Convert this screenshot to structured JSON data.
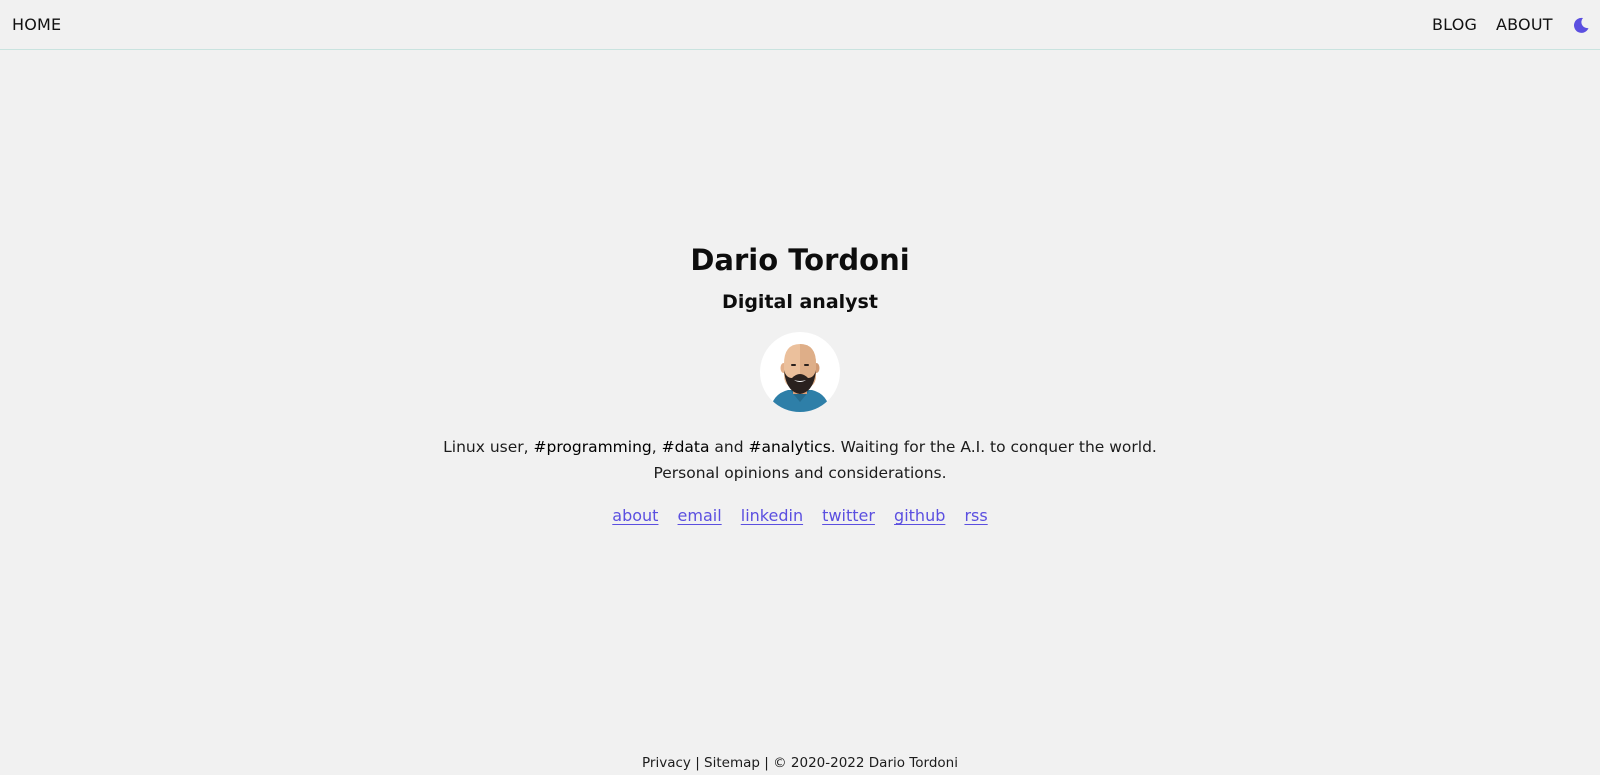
{
  "nav": {
    "home": "HOME",
    "blog": "BLOG",
    "about": "ABOUT",
    "theme_icon": "moon-icon",
    "accent_color": "#5b4fe0"
  },
  "hero": {
    "name": "Dario Tordoni",
    "role": "Digital analyst",
    "avatar_icon": "bearded-man-avatar",
    "bio": {
      "part1": "Linux user, ",
      "tag1": "#programming",
      "part2": ", ",
      "tag2": "#data",
      "part3": " and ",
      "tag3": "#analytics",
      "part4": ". Waiting for the A.I. to conquer the world.",
      "line2": "Personal opinions and considerations."
    },
    "links": [
      "about",
      "email",
      "linkedin",
      "twitter",
      "github",
      "rss"
    ]
  },
  "footer": {
    "privacy": "Privacy",
    "sep1": " | ",
    "sitemap": "Sitemap",
    "sep2": " | ",
    "copyright": "© 2020-2022 Dario Tordoni"
  }
}
